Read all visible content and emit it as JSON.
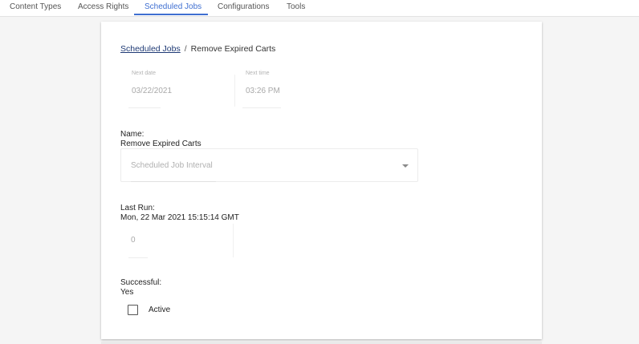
{
  "tabs": [
    {
      "label": "Content Types"
    },
    {
      "label": "Access Rights"
    },
    {
      "label": "Scheduled Jobs",
      "active": true
    },
    {
      "label": "Configurations"
    },
    {
      "label": "Tools"
    }
  ],
  "breadcrumb": {
    "parent": "Scheduled Jobs",
    "separator": "/",
    "current": "Remove Expired Carts"
  },
  "next_date": {
    "label": "Next date",
    "value": "03/22/2021"
  },
  "next_time": {
    "label": "Next time",
    "value": "03:26 PM"
  },
  "name": {
    "label": "Name:",
    "value": "Remove Expired Carts"
  },
  "interval_select": {
    "placeholder": "Scheduled Job Interval"
  },
  "last_run": {
    "label": "Last Run:",
    "value": "Mon, 22 Mar 2021 15:15:14 GMT"
  },
  "number_field": {
    "value": "0"
  },
  "successful": {
    "label": "Successful:",
    "value": "Yes"
  },
  "active_checkbox": {
    "label": "Active",
    "checked": false
  },
  "colors": {
    "accent": "#3f6fd1",
    "link": "#1f3a75",
    "background": "#f5f5f5"
  }
}
